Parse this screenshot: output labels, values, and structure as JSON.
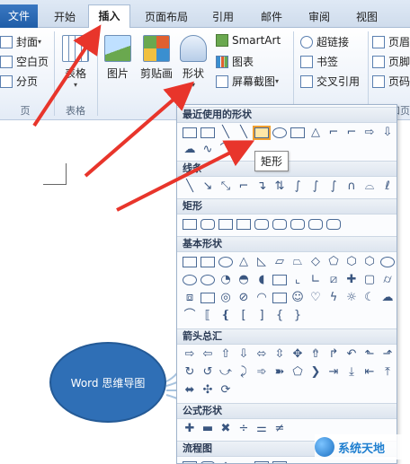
{
  "tabs": [
    {
      "label": "文件"
    },
    {
      "label": "开始"
    },
    {
      "label": "插入"
    },
    {
      "label": "页面布局"
    },
    {
      "label": "引用"
    },
    {
      "label": "邮件"
    },
    {
      "label": "审阅"
    },
    {
      "label": "视图"
    }
  ],
  "ribbon": {
    "pages": {
      "cover": "封面",
      "blank": "空白页",
      "break": "分页",
      "group": "页"
    },
    "table": {
      "label": "表格",
      "group": "表格"
    },
    "illustrations": {
      "picture": "图片",
      "clipart": "剪贴画",
      "shapes": "形状",
      "smartart": "SmartArt",
      "chart": "图表",
      "screenshot": "屏幕截图"
    },
    "links": {
      "hyperlink": "超链接",
      "bookmark": "书签",
      "crossref": "交叉引用",
      "group": "链接"
    },
    "header": {
      "header": "页眉",
      "footer": "页脚",
      "pagenum": "页码",
      "group": "页眉和页"
    }
  },
  "shapes_menu": {
    "sections": [
      {
        "title": "最近使用的形状"
      },
      {
        "title": "线条"
      },
      {
        "title": "矩形"
      },
      {
        "title": "基本形状"
      },
      {
        "title": "箭头总汇"
      },
      {
        "title": "公式形状"
      },
      {
        "title": "流程图"
      }
    ],
    "tooltip": "矩形"
  },
  "document": {
    "mindmap_node": "Word 思维导图"
  },
  "watermark": {
    "text": "系统天地"
  },
  "colors": {
    "accent": "#2f6fb6",
    "arrow": "#e8352b",
    "file_tab": "#1f5ea8"
  }
}
